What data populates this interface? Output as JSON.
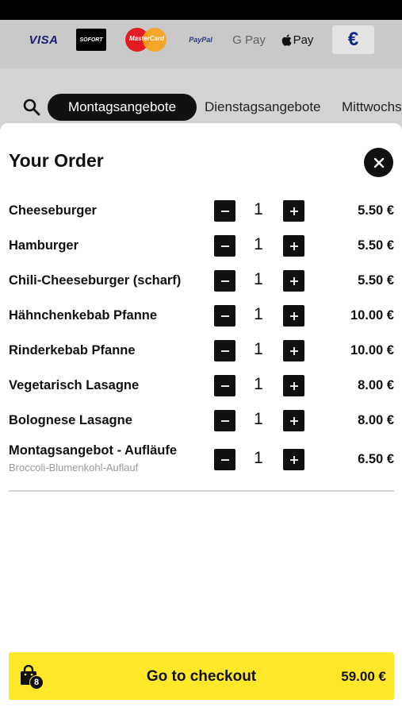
{
  "payment_methods": {
    "visa": "VISA",
    "sofort": "SOFORT",
    "mastercard": "MasterCard",
    "paypal": "PayPal",
    "gpay": "G Pay",
    "apple_pay": "Pay",
    "currency": "€"
  },
  "day_tabs": [
    "Montagsangebote",
    "Dienstagsangebote",
    "Mittwochs"
  ],
  "order": {
    "title": "Your Order",
    "items": [
      {
        "name": "Cheeseburger",
        "qty": "1",
        "price": "5.50 €"
      },
      {
        "name": "Hamburger",
        "qty": "1",
        "price": "5.50 €"
      },
      {
        "name": "Chili-Cheeseburger (scharf)",
        "qty": "1",
        "price": "5.50 €"
      },
      {
        "name": "Hähnchenkebab Pfanne",
        "qty": "1",
        "price": "10.00 €"
      },
      {
        "name": "Rinderkebab Pfanne",
        "qty": "1",
        "price": "10.00 €"
      },
      {
        "name": "Vegetarisch Lasagne",
        "qty": "1",
        "price": "8.00 €"
      },
      {
        "name": "Bolognese Lasagne",
        "qty": "1",
        "price": "8.00 €"
      },
      {
        "name": "Montagsangebot - Aufläufe",
        "sub": "Broccoli-Blumenkohl-Auflauf",
        "qty": "1",
        "price": "6.50 €"
      }
    ]
  },
  "checkout": {
    "label": "Go to checkout",
    "total": "59.00 €",
    "item_count": "8"
  },
  "colors": {
    "accent_yellow": "#ffe82a",
    "dark": "#111111"
  },
  "icons": {
    "search": "search-icon",
    "close": "close-icon",
    "minus": "minus-icon",
    "plus": "plus-icon",
    "bag": "shopping-bag-icon"
  }
}
